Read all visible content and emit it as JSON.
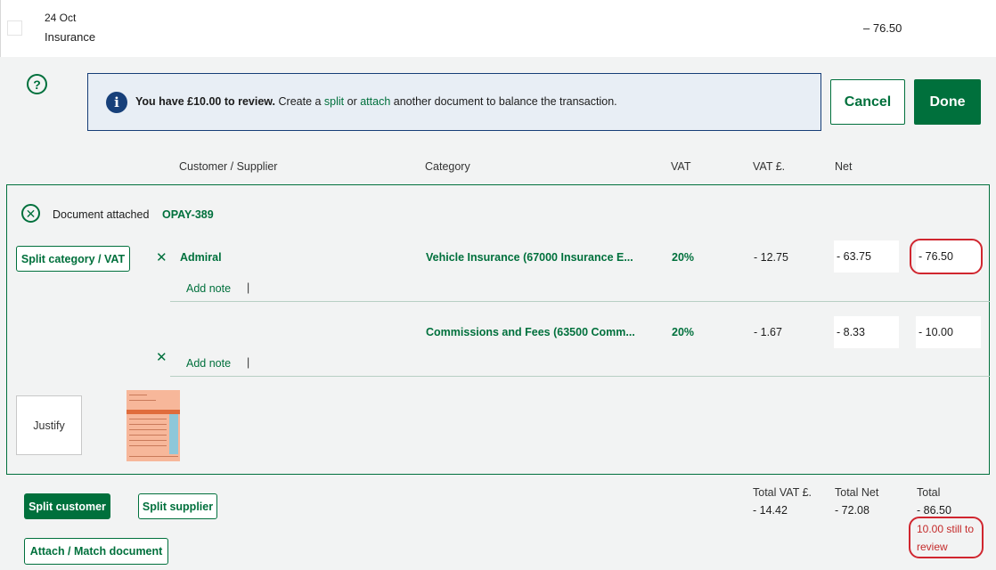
{
  "transaction": {
    "date": "24 Oct",
    "name": "Insurance",
    "amount": "– 76.50"
  },
  "info": {
    "bold_text": "You have £10.00 to review.",
    "text_1": " Create a ",
    "split_link": "split",
    "text_2": " or ",
    "attach_link": "attach",
    "text_3": " another document to balance the transaction."
  },
  "actions": {
    "cancel": "Cancel",
    "done": "Done"
  },
  "columns": {
    "customer_supplier": "Customer / Supplier",
    "category": "Category",
    "vat": "VAT",
    "vat_amount": "VAT £.",
    "net": "Net"
  },
  "document": {
    "label": "Document attached",
    "reference": "OPAY-389"
  },
  "split_category_label": "Split category / VAT",
  "lines": [
    {
      "supplier": "Admiral",
      "category": "Vehicle Insurance (67000 Insurance E...",
      "vat_rate": "20%",
      "vat_amount": "- 12.75",
      "net": "- 63.75",
      "total": "- 76.50",
      "add_note": "Add note"
    },
    {
      "supplier": "",
      "category": "Commissions and Fees (63500 Comm...",
      "vat_rate": "20%",
      "vat_amount": "- 1.67",
      "net": "- 8.33",
      "total": "- 10.00",
      "add_note": "Add note"
    }
  ],
  "justify_label": "Justify",
  "buttons": {
    "split_customer": "Split customer",
    "split_supplier": "Split supplier",
    "attach_match": "Attach / Match document"
  },
  "totals": {
    "vat_label": "Total VAT £.",
    "vat_value": "- 14.42",
    "net_label": "Total Net",
    "net_value": "- 72.08",
    "total_label": "Total",
    "total_value": "- 86.50",
    "review_line1": "10.00 still to",
    "review_line2": "review"
  },
  "colors": {
    "accent": "#00703c",
    "info_border": "#163d77",
    "alert": "#d0262f"
  }
}
